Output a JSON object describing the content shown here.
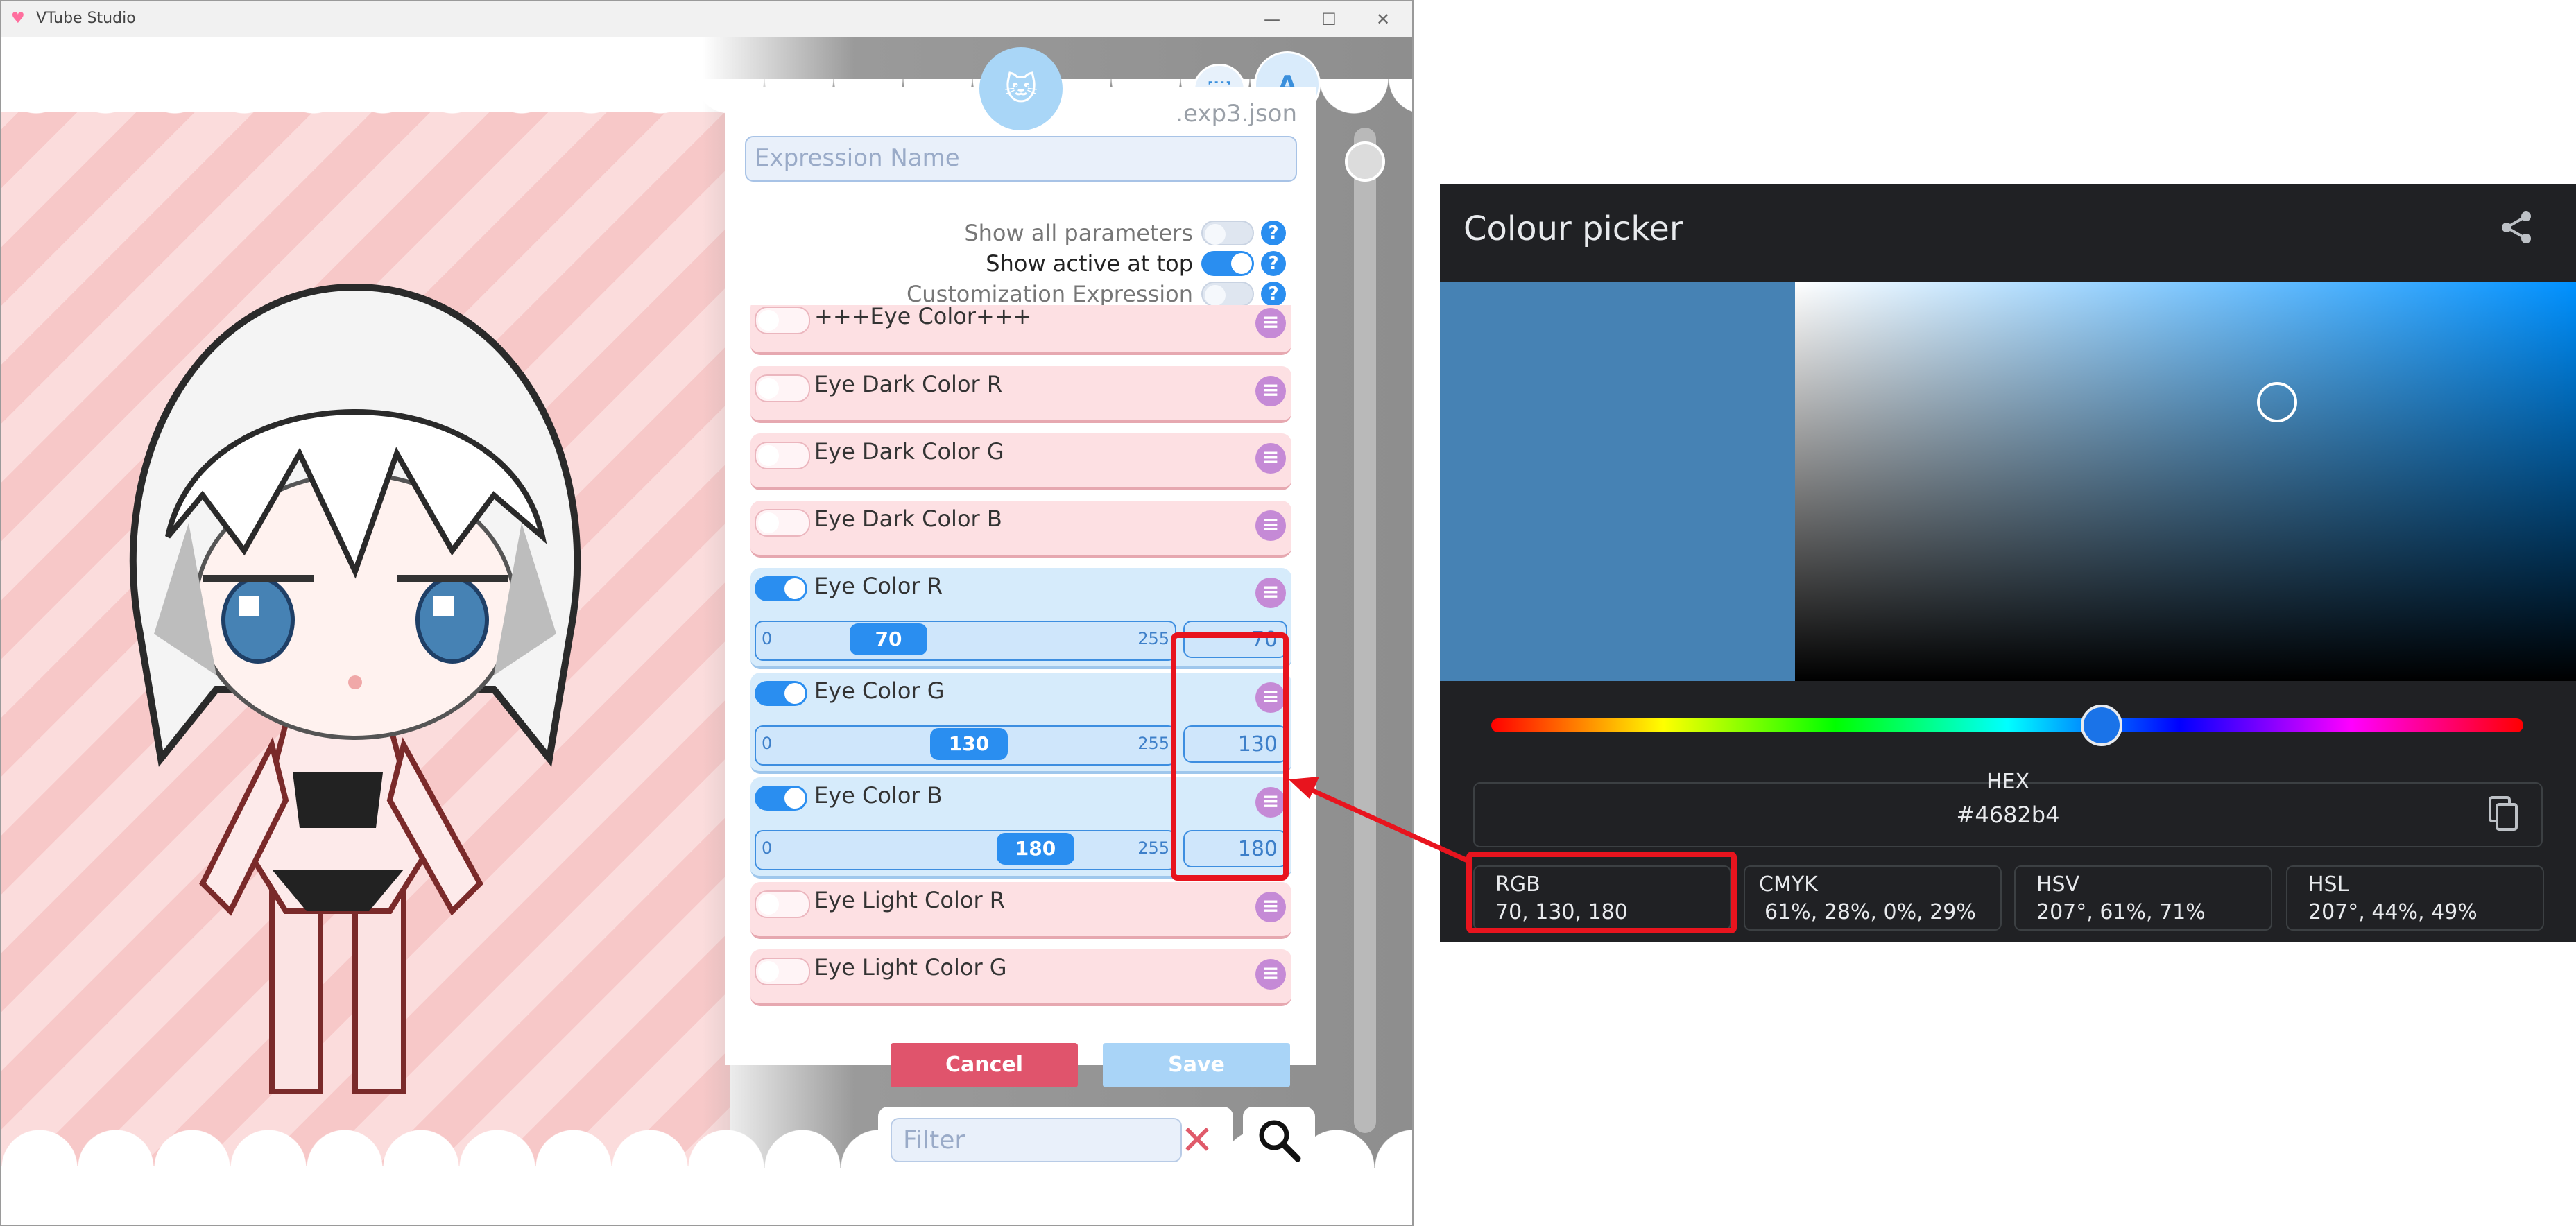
{
  "window": {
    "title": "VTube Studio",
    "minimize": "—",
    "maximize": "☐",
    "close": "✕"
  },
  "editor": {
    "file_extension": ".exp3.json",
    "name_placeholder": "Expression Name",
    "options": [
      {
        "label": "Show all parameters",
        "on": false
      },
      {
        "label": "Show active at top",
        "on": true
      },
      {
        "label": "Customization Expression",
        "on": false
      }
    ],
    "help_glyph": "?",
    "params": [
      {
        "label": "+++Eye Color+++",
        "on": false
      },
      {
        "label": "Eye Dark Color R",
        "on": false
      },
      {
        "label": "Eye Dark Color G",
        "on": false
      },
      {
        "label": "Eye Dark Color B",
        "on": false
      },
      {
        "label": "Eye Color R",
        "on": true,
        "min": "0",
        "max": "255",
        "value": "70"
      },
      {
        "label": "Eye Color G",
        "on": true,
        "min": "0",
        "max": "255",
        "value": "130"
      },
      {
        "label": "Eye Color B",
        "on": true,
        "min": "0",
        "max": "255",
        "value": "180"
      },
      {
        "label": "Eye Light Color R",
        "on": false
      },
      {
        "label": "Eye Light Color G",
        "on": false
      }
    ],
    "cancel_label": "Cancel",
    "save_label": "Save",
    "filter_placeholder": "Filter"
  },
  "picker": {
    "title": "Colour picker",
    "hex_label": "HEX",
    "hex_value": "#4682b4",
    "swatch_color": "#4682b4",
    "formats": [
      {
        "label": "RGB",
        "value": "70, 130, 180"
      },
      {
        "label": "CMYK",
        "value": "61%, 28%, 0%, 29%"
      },
      {
        "label": "HSV",
        "value": "207°, 61%, 71%"
      },
      {
        "label": "HSL",
        "value": "207°, 44%, 49%"
      }
    ]
  },
  "colors": {
    "accent": "#2a8ef0",
    "cancel": "#e0546c",
    "annotation": "#e8141e"
  }
}
